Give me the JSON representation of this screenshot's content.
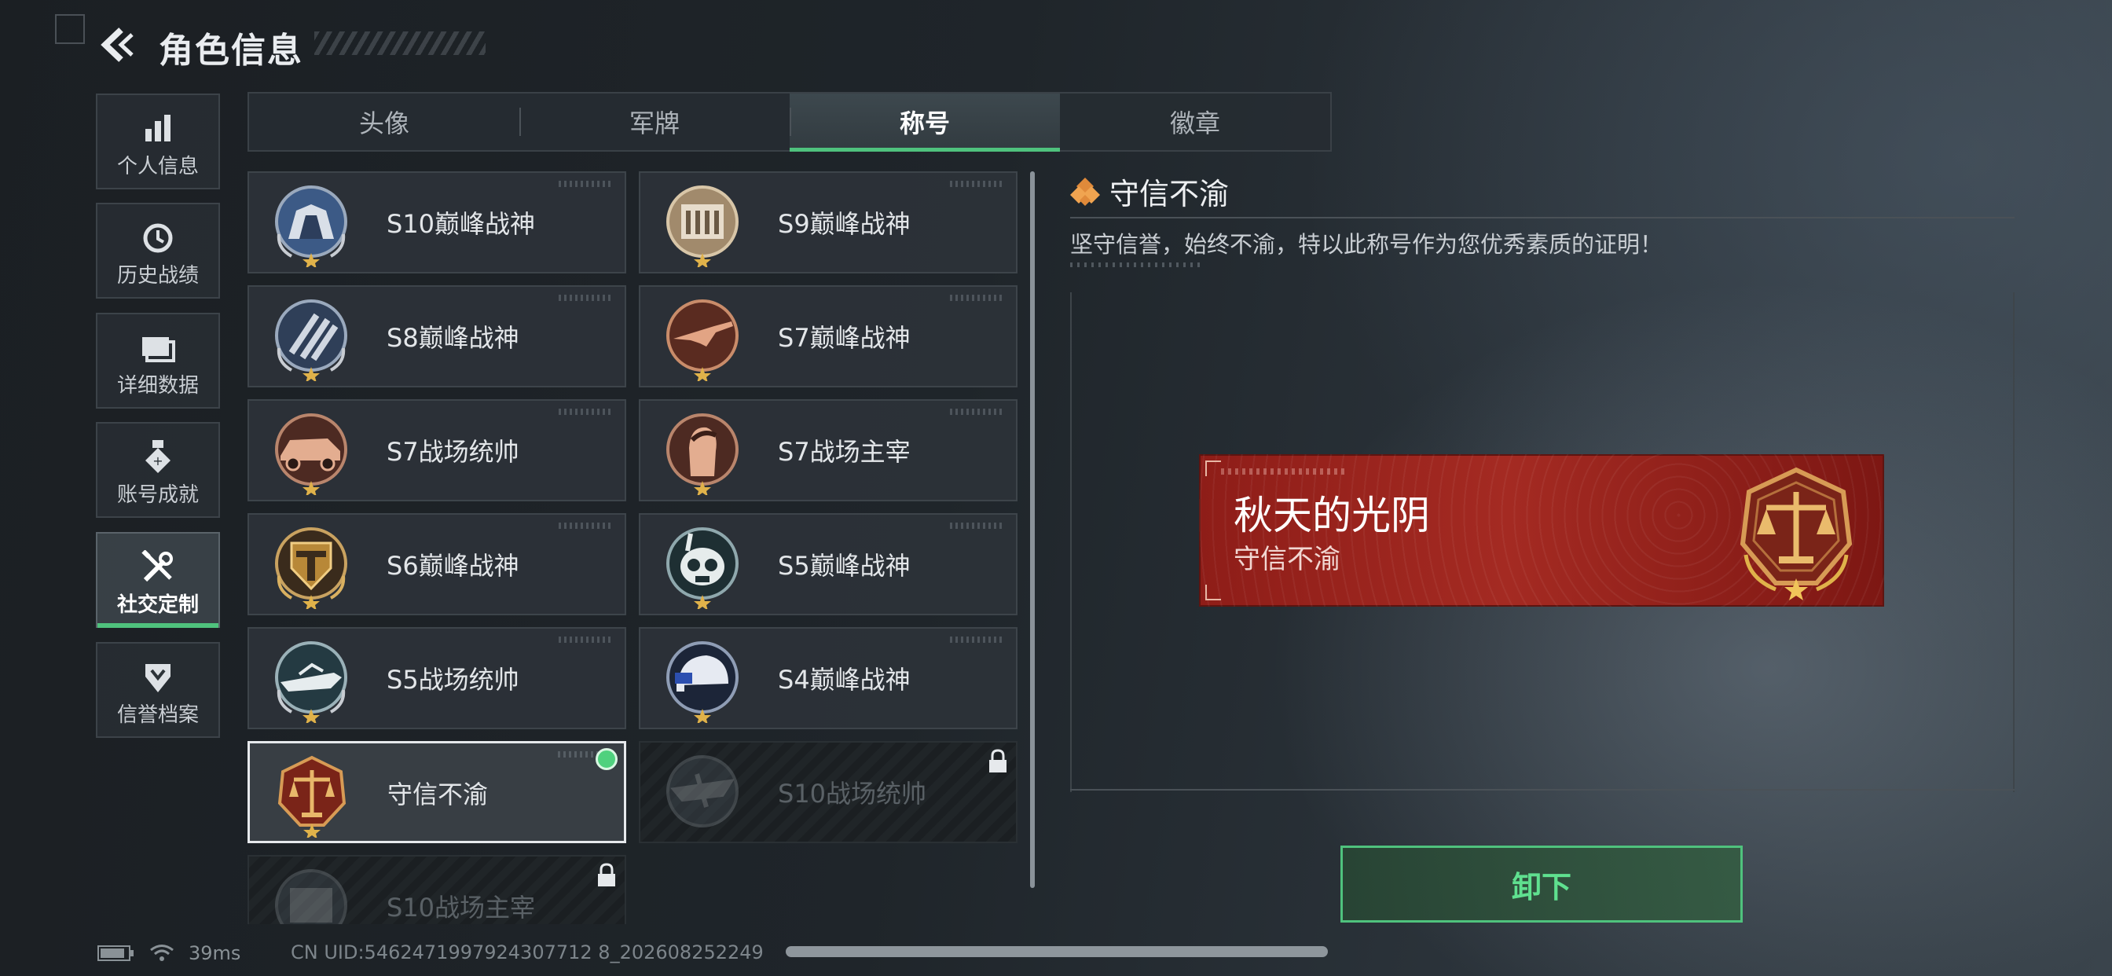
{
  "header": {
    "title": "角色信息",
    "back_icon": "back-arrow-icon"
  },
  "sidebar": {
    "items": [
      {
        "label": "个人信息",
        "icon": "bar-chart-icon",
        "active": false
      },
      {
        "label": "历史战绩",
        "icon": "history-clock-icon",
        "active": false
      },
      {
        "label": "详细数据",
        "icon": "folder-icon",
        "active": false
      },
      {
        "label": "账号成就",
        "icon": "medal-icon",
        "active": false
      },
      {
        "label": "社交定制",
        "icon": "wrench-screwdriver-icon",
        "active": true
      },
      {
        "label": "信誉档案",
        "icon": "shield-chevron-icon",
        "active": false
      }
    ]
  },
  "tabs": [
    {
      "label": "头像",
      "active": false
    },
    {
      "label": "军牌",
      "active": false
    },
    {
      "label": "称号",
      "active": true
    },
    {
      "label": "徽章",
      "active": false
    }
  ],
  "titles_list": [
    {
      "name": "S10巅峰战神",
      "state": "normal",
      "emblem": "pagoda-emblem"
    },
    {
      "name": "S9巅峰战神",
      "state": "normal",
      "emblem": "fortress-emblem"
    },
    {
      "name": "S8巅峰战神",
      "state": "normal",
      "emblem": "stripes-emblem"
    },
    {
      "name": "S7巅峰战神",
      "state": "normal",
      "emblem": "rifle-emblem"
    },
    {
      "name": "S7战场统帅",
      "state": "normal",
      "emblem": "armored-car-emblem"
    },
    {
      "name": "S7战场主宰",
      "state": "normal",
      "emblem": "soldier-portrait-emblem"
    },
    {
      "name": "S6巅峰战神",
      "state": "normal",
      "emblem": "t-shield-emblem"
    },
    {
      "name": "S5巅峰战神",
      "state": "normal",
      "emblem": "skull-diver-emblem"
    },
    {
      "name": "S5战场统帅",
      "state": "normal",
      "emblem": "speedboat-emblem"
    },
    {
      "name": "S4巅峰战神",
      "state": "normal",
      "emblem": "helmet-nightvision-emblem"
    },
    {
      "name": "守信不渝",
      "state": "selected",
      "emblem": "scales-emblem"
    },
    {
      "name": "S10战场统帅",
      "state": "locked",
      "emblem": "aircraft-emblem"
    },
    {
      "name": "S10战场主宰",
      "state": "locked",
      "emblem": "building-emblem"
    }
  ],
  "detail": {
    "title": "守信不渝",
    "title_icon": "diamond-cluster-icon",
    "description": "坚守信誉，始终不渝，特以此称号作为您优秀素质的证明！",
    "banner": {
      "player_name": "秋天的光阴",
      "title_text": "守信不渝",
      "emblem": "scales-emblem"
    },
    "action_label": "卸下"
  },
  "status": {
    "ping": "39ms",
    "uid": "CN UID:5462471997924307712 8_202608252249",
    "battery_icon": "battery-icon",
    "wifi_icon": "wifi-icon"
  },
  "colors": {
    "accent_green": "#4fc27d",
    "banner_red": "#9e261f",
    "gold": "#d7a24a"
  }
}
